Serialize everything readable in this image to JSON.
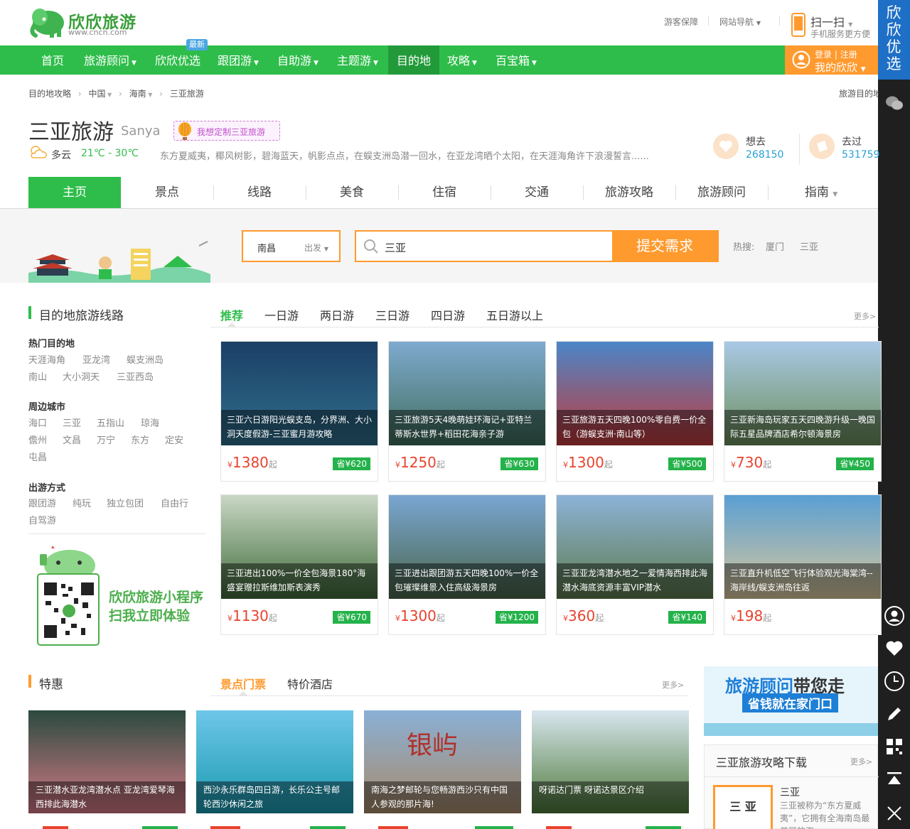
{
  "header": {
    "logo_text": "欣欣旅游",
    "logo_url": "www.cncn.com",
    "links": [
      "游客保障",
      "网站导航"
    ],
    "scan_title": "扫一扫",
    "scan_sub": "手机服务更方便"
  },
  "nav": {
    "items": [
      {
        "label": "首页",
        "caret": false
      },
      {
        "label": "旅游顾问",
        "caret": true
      },
      {
        "label": "欣欣优选",
        "caret": false
      },
      {
        "label": "跟团游",
        "caret": true
      },
      {
        "label": "自助游",
        "caret": true
      },
      {
        "label": "主题游",
        "caret": true
      },
      {
        "label": "目的地",
        "caret": false
      },
      {
        "label": "攻略",
        "caret": true
      },
      {
        "label": "百宝箱",
        "caret": true
      }
    ],
    "new_badge": "最新",
    "login": "登录",
    "register": "注册",
    "my": "我的欣欣"
  },
  "side_banner": "欣欣优选",
  "breadcrumb": {
    "items": [
      "目的地攻略",
      "中国",
      "海南",
      "三亚旅游"
    ],
    "right": "旅游目的地"
  },
  "destination": {
    "title": "三亚旅游",
    "title_en": "Sanya",
    "custom_btn": "我想定制三亚旅游",
    "weather": "多云",
    "temp": "21℃ - 30℃",
    "desc": "东方夏威夷，椰风树影，碧海蓝天，帆影点点，在蜈支洲岛潜一回水，在亚龙湾晒个太阳，在天涯海角许下浪漫誓言......",
    "want_label": "想去",
    "want_count": "268150",
    "been_label": "去过",
    "been_count": "531759"
  },
  "tabs": [
    "主页",
    "景点",
    "线路",
    "美食",
    "住宿",
    "交通",
    "旅游攻略",
    "旅游顾问",
    "指南"
  ],
  "search": {
    "from": "南昌",
    "from_suffix": "出发",
    "keyword": "三亚",
    "submit": "提交需求",
    "hot_label": "热搜:",
    "hot": [
      "厦门",
      "三亚"
    ]
  },
  "routes": {
    "title": "目的地旅游线路",
    "filters": [
      "推荐",
      "一日游",
      "两日游",
      "三日游",
      "四日游",
      "五日游以上"
    ],
    "more": "更多>",
    "groups": [
      {
        "title": "热门目的地",
        "rows": [
          [
            "天涯海角",
            "亚龙湾",
            "蜈支洲岛"
          ],
          [
            "南山",
            "大小洞天",
            "三亚西岛"
          ]
        ]
      },
      {
        "title": "周边城市",
        "rows": [
          [
            "海口",
            "三亚",
            "五指山",
            "琼海"
          ],
          [
            "儋州",
            "文昌",
            "万宁",
            "东方",
            "定安"
          ],
          [
            "屯昌"
          ]
        ]
      },
      {
        "title": "出游方式",
        "rows": [
          [
            "跟团游",
            "纯玩",
            "独立包团",
            "自由行"
          ],
          [
            "自驾游"
          ]
        ]
      }
    ],
    "miniapp_line1": "欣欣旅游小程序",
    "miniapp_line2": "扫我立即体验",
    "cards": [
      {
        "title": "三亚六日游阳光蜈支岛，分界洲、大小洞天度假游-三亚蜜月游攻略",
        "price": "1380",
        "save": "省¥620",
        "colors": [
          "#1b3f66",
          "#2f6f8c"
        ]
      },
      {
        "title": "三亚旅游5天4晚萌娃环海记+亚特兰蒂斯水世界+稻田花海亲子游",
        "price": "1250",
        "save": "省¥630",
        "colors": [
          "#7fa9cf",
          "#3f6f5c"
        ]
      },
      {
        "title": "三亚旅游五天四晚100%零自费一价全包（游蜈支洲·南山等）",
        "price": "1300",
        "save": "省¥500",
        "colors": [
          "#4b86c8",
          "#c23a3a"
        ]
      },
      {
        "title": "三亚新海岛玩家五天四晚游升级一晚国际五星品牌酒店希尔顿海景房",
        "price": "730",
        "save": "省¥450",
        "colors": [
          "#a9c8e6",
          "#6b8f5a"
        ]
      },
      {
        "title": "三亚进出100%一价全包海景180°海盛宴赠拉斯维加斯表演秀",
        "price": "1130",
        "save": "省¥670",
        "colors": [
          "#c9d7c4",
          "#3f6b3a"
        ]
      },
      {
        "title": "三亚进出跟团游五天四晚100%一价全包璀璨维景入住高级海景房",
        "price": "1300",
        "save": "省¥1200",
        "colors": [
          "#7aa6d2",
          "#49654a"
        ]
      },
      {
        "title": "三亚亚龙湾潜水地之一爱情海西排此海潜水海底资源丰富VIP潜水",
        "price": "360",
        "save": "省¥140",
        "colors": [
          "#8db3d8",
          "#5d7a4c"
        ]
      },
      {
        "title": "三亚直升机低空飞行体验观光海棠湾--海岸线/蜈支洲岛往返",
        "price": "198",
        "save": "",
        "colors": [
          "#5a9fd4",
          "#d9c79a"
        ]
      }
    ]
  },
  "deals": {
    "title": "特惠",
    "tabs": [
      "景点门票",
      "特价酒店"
    ],
    "more": "更多>",
    "cards": [
      {
        "title": "三亚潜水亚龙湾潜水点 亚龙湾爱琴海西排此海潜水",
        "colors": [
          "#2b4a3f",
          "#d47a86"
        ]
      },
      {
        "title": "西沙永乐群岛四日游，长乐公主号邮轮西沙休闲之旅",
        "colors": [
          "#6ec6e8",
          "#1a9ab0"
        ]
      },
      {
        "title": "南海之梦邮轮与您畅游西沙只有中国人参观的那片海!",
        "colors": [
          "#8ab0d6",
          "#a88a6a"
        ],
        "rock_text": "银屿"
      },
      {
        "title": "呀诺达门票 呀诺达景区介绍",
        "colors": [
          "#d8e6ef",
          "#4f7a3a"
        ]
      }
    ]
  },
  "ads": {
    "line1a": "旅游顾问",
    "line1b": "带您走",
    "line2": "省钱就在家门口"
  },
  "guide": {
    "title": "三亚旅游攻略下载",
    "more": "更多>",
    "book_title": "三 亚",
    "book_name": "三亚",
    "book_desc": "三亚被称为“东方夏威夷”，它拥有全海南岛最美丽的海"
  }
}
